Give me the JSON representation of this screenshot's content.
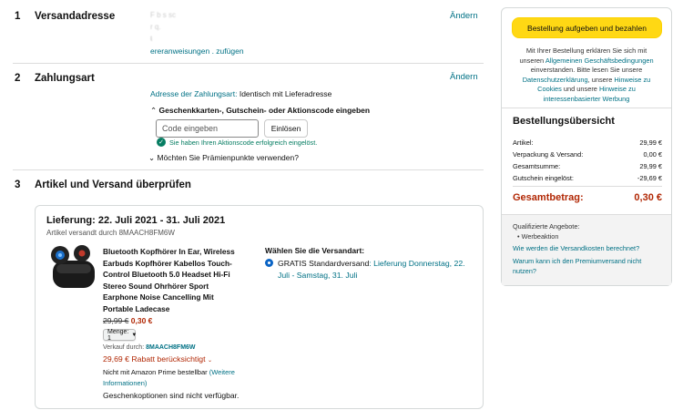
{
  "sections": {
    "address": {
      "num": "1",
      "title": "Versandadresse",
      "change": "Ändern",
      "line1": "F  b s  sc",
      "line2": "r  q.  ",
      "line3": "ŧ ",
      "instructions_link": "ereranweisungen  .  zufügen"
    },
    "payment": {
      "num": "2",
      "title": "Zahlungsart",
      "change": "Ändern",
      "billing_label": "Adresse der Zahlungsart:",
      "billing_value": "Identisch mit Lieferadresse",
      "giftcard_toggle": "Geschenkkarten-, Gutschein- oder Aktionscode eingeben",
      "code_placeholder": "Code eingeben",
      "redeem_label": "Einlösen",
      "code_success": "Sie haben Ihren Aktionscode erfolgreich eingelöst.",
      "points_toggle": "Möchten Sie Prämienpunkte verwenden?"
    },
    "review": {
      "num": "3",
      "title": "Artikel und Versand überprüfen"
    }
  },
  "delivery": {
    "heading": "Lieferung: 22. Juli 2021 - 31. Juli 2021",
    "shipped_by": "Artikel versandt durch 8MAACH8FM6W",
    "product_title_lines": [
      "Bluetooth Kopfhörer In Ear, Wireless",
      "Earbuds Kopfhörer Kabellos Touch-",
      "Control Bluetooth 5.0 Headset Hi-Fi",
      "Stereo Sound Ohrhörer Sport",
      "Earphone Noise Cancelling Mit",
      "Portable Ladecase"
    ],
    "old_price": "29,99 €",
    "new_price": "0,30 €",
    "quantity_label": "Menge: 1",
    "seller_label": "Verkauf durch:",
    "seller_name": "8MAACH8FM6W",
    "discount": "29,69 € Rabatt berücksichtigt",
    "prime_note": "Nicht mit Amazon Prime bestellbar",
    "prime_more": "(Weitere Informationen)",
    "gift_note": "Geschenkoptionen sind nicht verfügbar.",
    "shipping_heading": "Wählen Sie die Versandart:",
    "shipping_option": "GRATIS Standardversand",
    "shipping_dates": ": Lieferung Donnerstag, 22. Juli - Samstag, 31. Juli"
  },
  "sidebar": {
    "place_order": "Bestellung aufgeben und bezahlen",
    "legal_1": "Mit Ihrer Bestellung erklären Sie sich mit",
    "legal_2": "unseren",
    "legal_agb": "Allgemeinen Geschäftsbedingungen",
    "legal_3": "einverstanden. Bitte lesen Sie unsere",
    "legal_privacy": "Datenschutzerklärung",
    "legal_4": ", unsere",
    "legal_cookies": "Hinweise zu Cookies",
    "legal_5": "und unsere",
    "legal_ads": "Hinweise zu interessenbasierter Werbung",
    "summary_title": "Bestellungsübersicht",
    "rows": [
      {
        "label": "Artikel:",
        "value": "29,99 €"
      },
      {
        "label": "Verpackung & Versand:",
        "value": "0,00 €"
      },
      {
        "label": "Gesamtsumme:",
        "value": "29,99 €"
      },
      {
        "label": "Gutschein eingelöst:",
        "value": "-29,69 €"
      }
    ],
    "total_label": "Gesamtbetrag:",
    "total_value": "0,30 €",
    "qualified_label": "Qualifizierte Angebote:",
    "qualified_item": "Werbeaktion",
    "faq_1": "Wie werden die Versandkosten berechnet?",
    "faq_2": "Warum kann ich den Premiumversand nicht nutzen?"
  },
  "colors": {
    "accent_link": "#007185",
    "price_red": "#b12704",
    "button_yellow": "#ffd814",
    "success_green": "#067d62"
  }
}
